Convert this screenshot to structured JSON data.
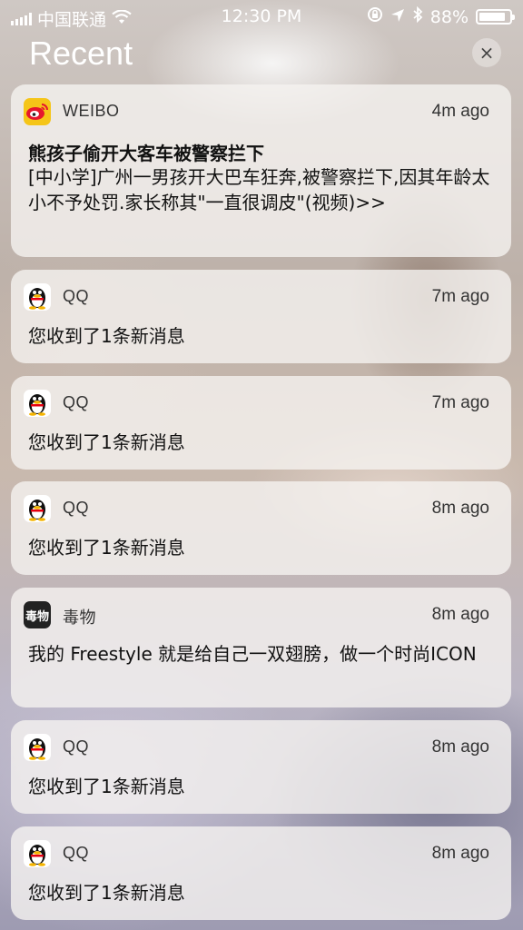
{
  "status_bar": {
    "carrier": "中国联通",
    "time": "12:30 PM",
    "battery_percent": "88%",
    "battery_level": 0.88,
    "icons": [
      "signal-icon",
      "wifi-icon",
      "rotation-lock-icon",
      "location-icon",
      "bluetooth-icon",
      "battery-icon"
    ]
  },
  "header": {
    "title": "Recent",
    "clear_label": "×"
  },
  "notifications": [
    {
      "app": "WEIBO",
      "icon": "weibo-icon",
      "time": "4m ago",
      "title": "熊孩子偷开大客车被警察拦下",
      "body": "[中小学]广州一男孩开大巴车狂奔,被警察拦下,因其年龄太小不予处罚.家长称其\"一直很调皮\"(视频)>>"
    },
    {
      "app": "QQ",
      "icon": "qq-icon",
      "time": "7m ago",
      "body": "您收到了1条新消息"
    },
    {
      "app": "QQ",
      "icon": "qq-icon",
      "time": "7m ago",
      "body": "您收到了1条新消息"
    },
    {
      "app": "QQ",
      "icon": "qq-icon",
      "time": "8m ago",
      "body": "您收到了1条新消息"
    },
    {
      "app": "毒物",
      "icon": "duwu-icon",
      "icon_text": "毒物",
      "time": "8m ago",
      "body": "我的 Freestyle 就是给自己一双翅膀，做一个时尚ICON"
    },
    {
      "app": "QQ",
      "icon": "qq-icon",
      "time": "8m ago",
      "body": "您收到了1条新消息"
    },
    {
      "app": "QQ",
      "icon": "qq-icon",
      "time": "8m ago",
      "body": "您收到了1条新消息"
    }
  ],
  "colors": {
    "weibo_icon_bg": "#f5c518",
    "card_bg": "rgba(245,242,240,0.80)",
    "status_text": "#ffffff"
  }
}
